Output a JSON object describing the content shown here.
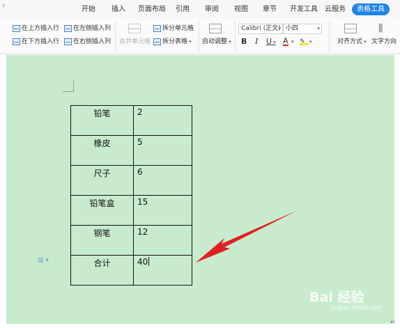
{
  "menu": {
    "tabs": [
      "开始",
      "插入",
      "页面布局",
      "引用",
      "审阅",
      "视图",
      "章节",
      "开发工具",
      "云服务"
    ],
    "active_tab": "表格工具"
  },
  "ribbon": {
    "insert_above": "在上方插入行",
    "insert_left": "在左侧插入列",
    "insert_below": "在下方插入行",
    "insert_right": "在右侧插入列",
    "merge_cells": "合并单元格",
    "split_cells": "拆分单元格",
    "split_table": "拆分表格",
    "auto_adjust": "自动调整",
    "font_name": "Calibri (正文)",
    "font_size": "小四",
    "bold": "B",
    "italic": "I",
    "underline": "U",
    "font_color": "A",
    "align": "对齐方式",
    "text_direction": "文字方向"
  },
  "table": {
    "rows": [
      {
        "name": "铅笔",
        "value": "2"
      },
      {
        "name": "橡皮",
        "value": "5"
      },
      {
        "name": "尺子",
        "value": "6"
      },
      {
        "name": "铅笔盒",
        "value": "15"
      },
      {
        "name": "钢笔",
        "value": "12"
      },
      {
        "name": "合计",
        "value": "40"
      }
    ]
  },
  "watermark": {
    "text": "Bai 经验",
    "sub": "jingyan.baidu.com"
  },
  "colors": {
    "doc_background": "#c8ebcd",
    "active_tab": "#1e84e6",
    "arrow": "#e02020"
  }
}
